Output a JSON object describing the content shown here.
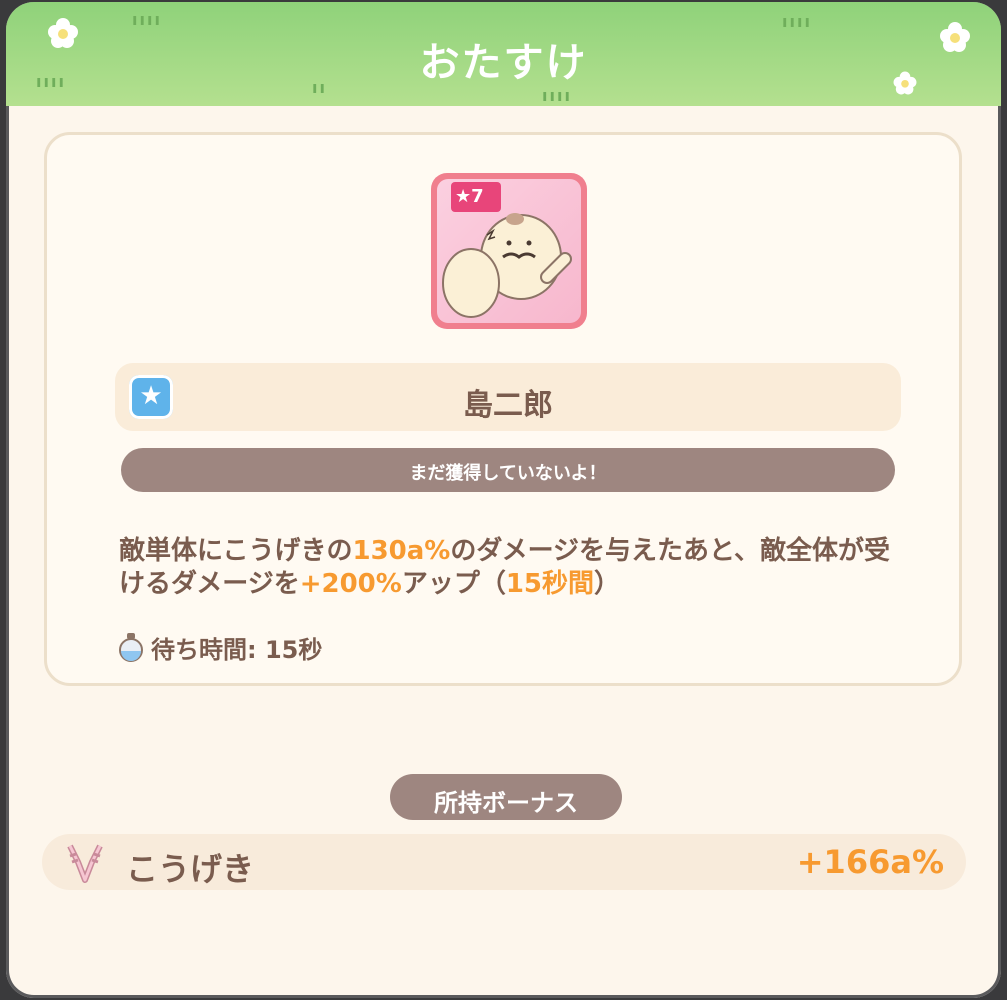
{
  "header": {
    "title": "おたすけ"
  },
  "character": {
    "star_level": "7",
    "name": "島二郎",
    "status": "まだ獲得していないよ！"
  },
  "skill": {
    "desc_1": "敵単体にこうげきの",
    "value_1": "130a%",
    "desc_2": "のダメージを与えたあと、敵全体が受けるダメージを",
    "value_2": "+200%",
    "desc_3": "アップ（",
    "value_3": "15秒間",
    "desc_4": "）",
    "wait_label": "待ち時間: 15秒"
  },
  "bonus": {
    "title": "所持ボーナス",
    "stat_label": "こうげき",
    "stat_value": "+166a%"
  },
  "colors": {
    "header_green": "#8fd27a",
    "accent_orange": "#f79a30",
    "text_brown": "#7a5c4e",
    "pill_gray": "#9e8680",
    "rarity_blue": "#5fb3ea"
  },
  "icons": {
    "rarity": "star-icon",
    "wait": "potion-icon",
    "bonus": "attack-icon"
  }
}
